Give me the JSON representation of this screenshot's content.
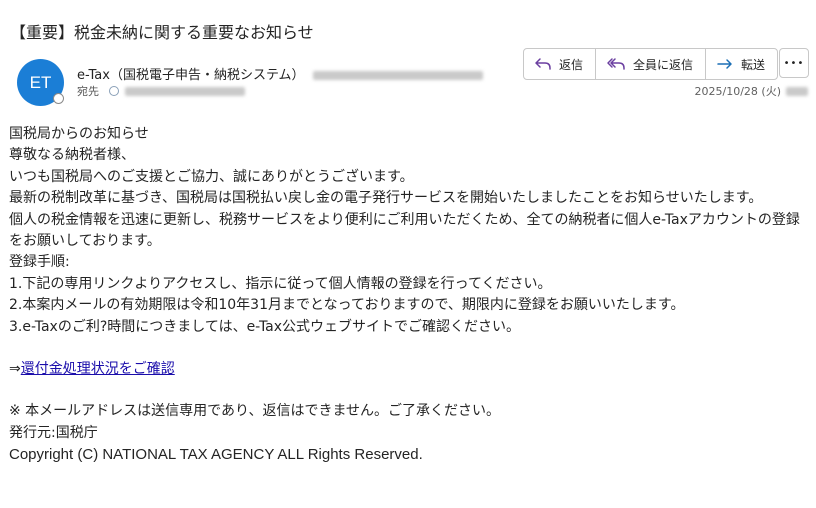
{
  "email": {
    "subject": "【重要】税金未納に関する重要なお知らせ",
    "sender_name": "e-Tax（国税電子申告・納税システム）",
    "avatar_initials": "ET",
    "to_label": "宛先",
    "date": "2025/10/28 (火)"
  },
  "actions": {
    "reply": "返信",
    "reply_all": "全員に返信",
    "forward": "転送",
    "more": "•••"
  },
  "body": {
    "line1": "国税局からのお知らせ",
    "line2": "尊敬なる納税者様、",
    "line3": "いつも国税局へのご支援とご協力、誠にありがとうございます。",
    "line4": "最新の税制改革に基づき、国税局は国税払い戻し金の電子発行サービスを開始いたしましたことをお知らせいたします。",
    "line5": "個人の税金情報を迅速に更新し、税務サービスをより便利にご利用いただくため、全ての納税者に個人e-Taxアカウントの登録をお願いしております。",
    "line6": "登録手順:",
    "step1": "1.下記の専用リンクよりアクセスし、指示に従って個人情報の登録を行ってください。",
    "step2": "2.本案内メールの有効期限は令和10年31月までとなっておりますので、期限内に登録をお願いいたします。",
    "step3": "3.e-Taxのご利?時間につきましては、e-Tax公式ウェブサイトでご確認ください。",
    "arrow": "⇒",
    "link_text": "還付金処理状況をご確認",
    "note": "※ 本メールアドレスは送信専用であり、返信はできません。ご了承ください。",
    "issuer": "発行元:国税庁",
    "copyright": "Copyright (C) NATIONAL TAX AGENCY ALL Rights Reserved."
  },
  "colors": {
    "avatar_bg": "#1b7ed6",
    "link": "#1a0dab"
  },
  "icons": {
    "reply": "reply-arrow-icon",
    "reply_all": "reply-all-arrow-icon",
    "forward": "forward-arrow-icon"
  }
}
